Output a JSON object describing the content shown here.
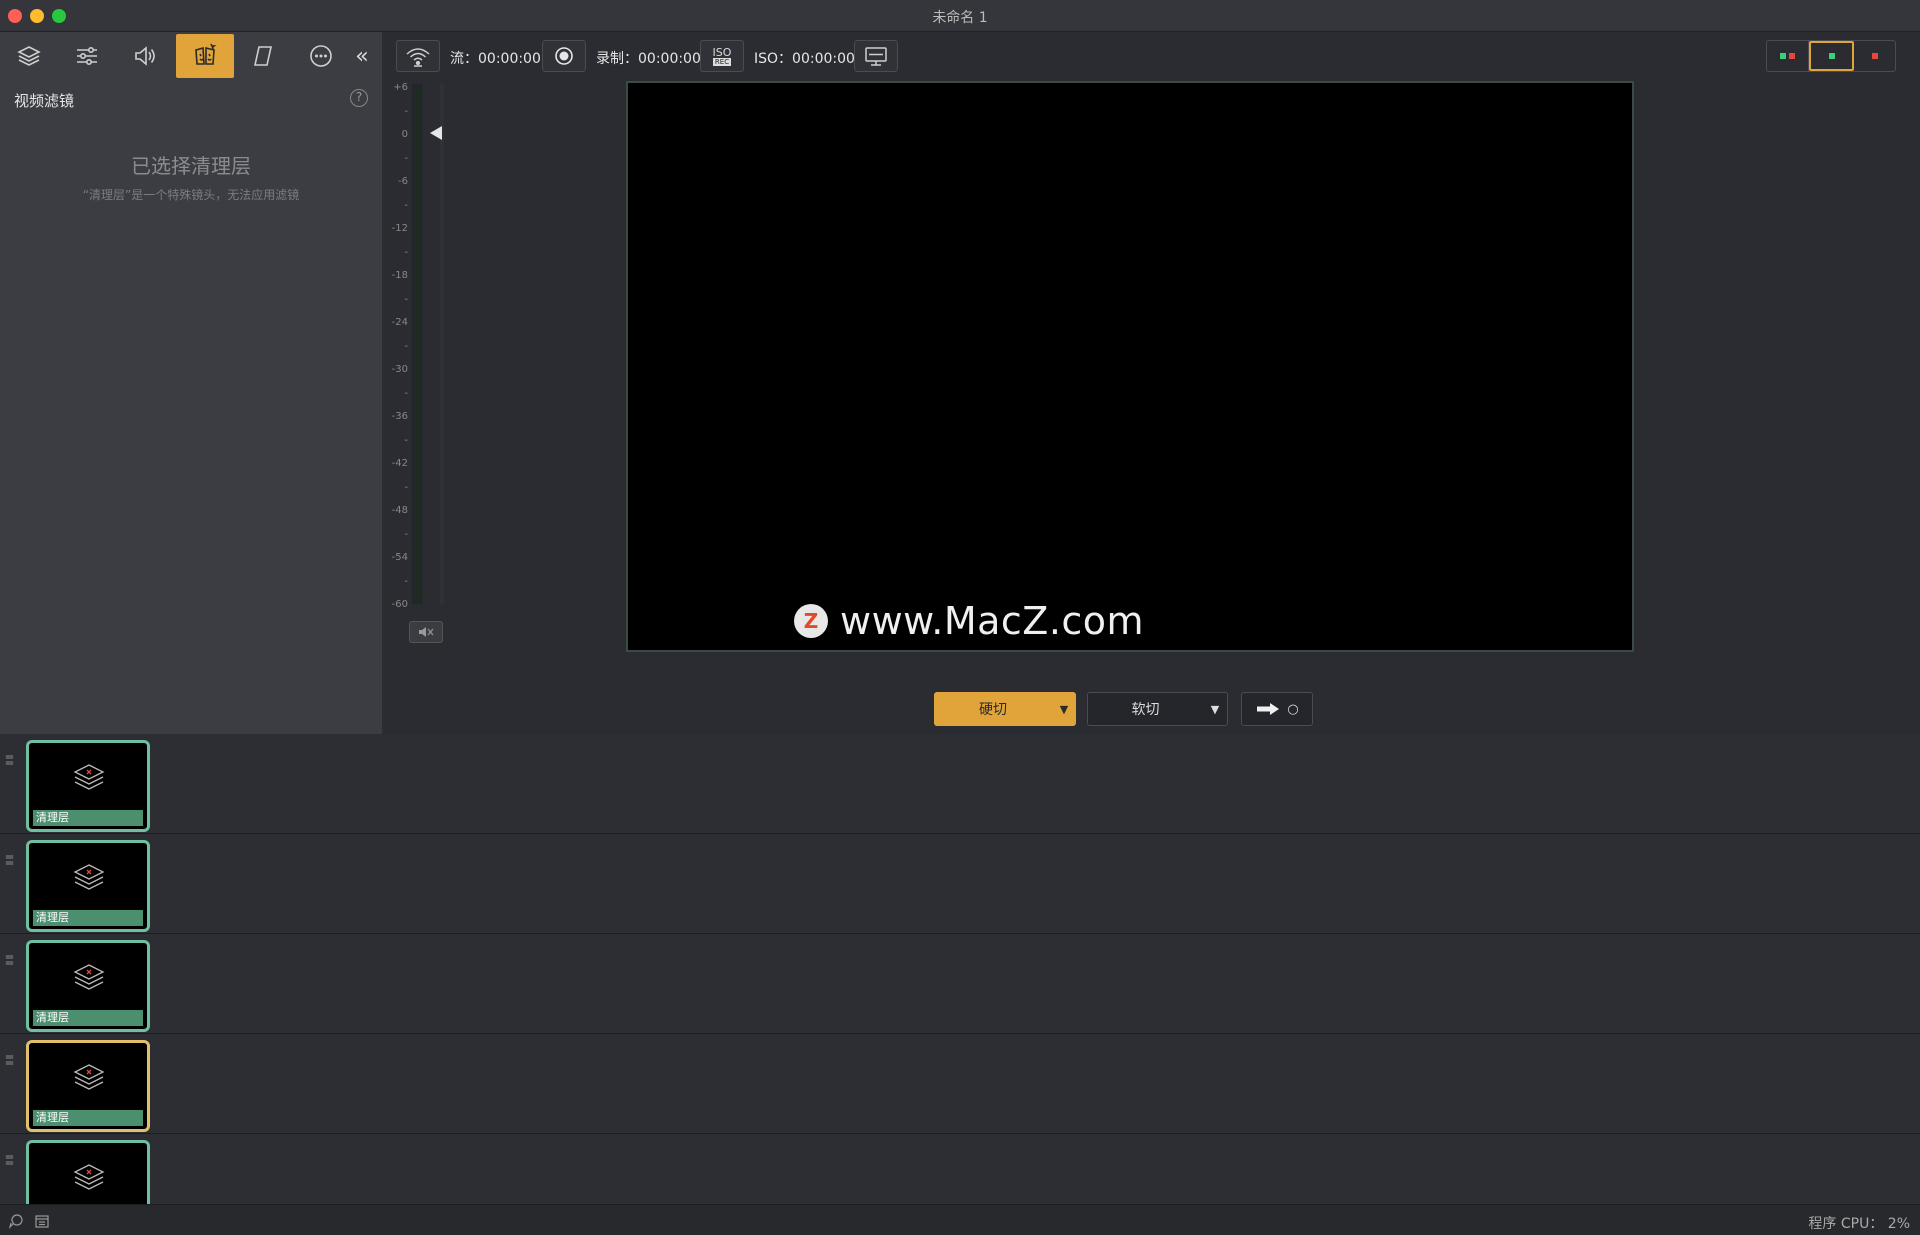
{
  "window": {
    "title": "未命名 1"
  },
  "left_panel": {
    "tabs": [
      {
        "name": "layers-icon"
      },
      {
        "name": "sliders-icon"
      },
      {
        "name": "speaker-icon"
      },
      {
        "name": "magic-filter-icon"
      },
      {
        "name": "parallelogram-icon"
      },
      {
        "name": "more-icon"
      }
    ],
    "collapse_glyph": "«",
    "title": "视频滤镜",
    "help_glyph": "?",
    "empty_title": "已选择清理层",
    "empty_subtitle": "“清理层”是一个特殊镜头，无法应用滤镜"
  },
  "toolbar": {
    "stream_label": "流：00:00:00",
    "record_label": "录制：00:00:00",
    "iso_label": "ISO：00:00:00",
    "iso_badge_top": "ISO",
    "iso_badge_bottom": "REC"
  },
  "meter": {
    "ticks": [
      "+6",
      "-",
      "0",
      "-",
      "-6",
      "-",
      "-12",
      "-",
      "-18",
      "-",
      "-24",
      "-",
      "-30",
      "-",
      "-36",
      "-",
      "-42",
      "-",
      "-48",
      "-",
      "-54",
      "-",
      "-60"
    ]
  },
  "preview": {
    "watermark": "www.MacZ.com",
    "watermark_logo": "Z"
  },
  "transitions": {
    "hard_cut": "硬切",
    "soft_cut": "软切",
    "caret": "▼",
    "auto_dot": "○"
  },
  "layers": [
    {
      "label": "清理层",
      "live": false
    },
    {
      "label": "清理层",
      "live": false
    },
    {
      "label": "清理层",
      "live": false
    },
    {
      "label": "清理层",
      "live": true
    },
    {
      "label": "",
      "live": false
    }
  ],
  "status": {
    "cpu": "程序 CPU：   2%"
  },
  "colors": {
    "accent": "#e0a43a",
    "thumb_border": "#6fbfa0",
    "live_border": "#e0c06a",
    "label_green": "#4b8f6e"
  }
}
